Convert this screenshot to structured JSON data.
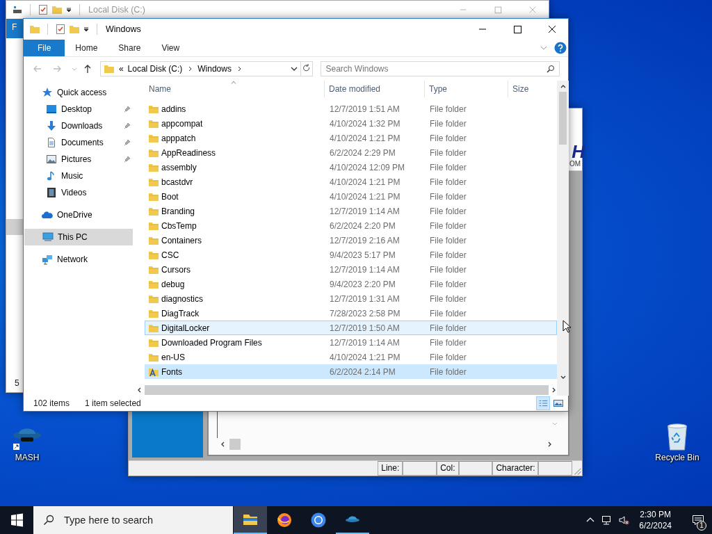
{
  "back_window": {
    "title": "Local Disk (C:)",
    "ribbon_tab": "F",
    "status_fragment": "5"
  },
  "editor_window": {
    "logo_mark": "H",
    "logo_caption": "OM",
    "status_bar": [
      {
        "label": "Line:"
      },
      {
        "label": "Col:"
      },
      {
        "label": "Character:"
      }
    ]
  },
  "explorer": {
    "title": "Windows",
    "ribbon_tabs": [
      {
        "label": "File",
        "selected": true
      },
      {
        "label": "Home",
        "selected": false
      },
      {
        "label": "Share",
        "selected": false
      },
      {
        "label": "View",
        "selected": false
      }
    ],
    "address": {
      "overflow": "«",
      "crumbs": [
        "Local Disk (C:)",
        "Windows"
      ]
    },
    "search": {
      "placeholder": "Search Windows"
    },
    "nav": [
      {
        "label": "Quick access",
        "kind": "star",
        "selected": false,
        "children": [
          {
            "label": "Desktop",
            "kind": "desktop",
            "pinned": true,
            "selected": false
          },
          {
            "label": "Downloads",
            "kind": "download",
            "pinned": true,
            "selected": false
          },
          {
            "label": "Documents",
            "kind": "document",
            "pinned": true,
            "selected": false
          },
          {
            "label": "Pictures",
            "kind": "pictures",
            "pinned": true,
            "selected": false
          },
          {
            "label": "Music",
            "kind": "music",
            "pinned": false,
            "selected": false
          },
          {
            "label": "Videos",
            "kind": "videos",
            "pinned": false,
            "selected": false
          }
        ]
      },
      {
        "label": "OneDrive",
        "kind": "cloud",
        "selected": false
      },
      {
        "label": "This PC",
        "kind": "pc",
        "selected": true
      },
      {
        "label": "Network",
        "kind": "network",
        "selected": false
      }
    ],
    "columns": [
      "Name",
      "Date modified",
      "Type",
      "Size"
    ],
    "rows": [
      {
        "name": "addins",
        "date": "12/7/2019 1:51 AM",
        "type": "File folder",
        "kind": "folder",
        "selected": false,
        "hovered": false
      },
      {
        "name": "appcompat",
        "date": "4/10/2024 1:32 PM",
        "type": "File folder",
        "kind": "folder",
        "selected": false,
        "hovered": false
      },
      {
        "name": "apppatch",
        "date": "4/10/2024 1:21 PM",
        "type": "File folder",
        "kind": "folder",
        "selected": false,
        "hovered": false
      },
      {
        "name": "AppReadiness",
        "date": "6/2/2024 2:29 PM",
        "type": "File folder",
        "kind": "folder",
        "selected": false,
        "hovered": false
      },
      {
        "name": "assembly",
        "date": "4/10/2024 12:09 PM",
        "type": "File folder",
        "kind": "folder",
        "selected": false,
        "hovered": false
      },
      {
        "name": "bcastdvr",
        "date": "4/10/2024 1:21 PM",
        "type": "File folder",
        "kind": "folder",
        "selected": false,
        "hovered": false
      },
      {
        "name": "Boot",
        "date": "4/10/2024 1:21 PM",
        "type": "File folder",
        "kind": "folder",
        "selected": false,
        "hovered": false
      },
      {
        "name": "Branding",
        "date": "12/7/2019 1:14 AM",
        "type": "File folder",
        "kind": "folder",
        "selected": false,
        "hovered": false
      },
      {
        "name": "CbsTemp",
        "date": "6/2/2024 2:20 PM",
        "type": "File folder",
        "kind": "folder",
        "selected": false,
        "hovered": false
      },
      {
        "name": "Containers",
        "date": "12/7/2019 2:16 AM",
        "type": "File folder",
        "kind": "folder",
        "selected": false,
        "hovered": false
      },
      {
        "name": "CSC",
        "date": "9/4/2023 5:17 PM",
        "type": "File folder",
        "kind": "folder",
        "selected": false,
        "hovered": false
      },
      {
        "name": "Cursors",
        "date": "12/7/2019 1:14 AM",
        "type": "File folder",
        "kind": "folder",
        "selected": false,
        "hovered": false
      },
      {
        "name": "debug",
        "date": "9/4/2023 2:20 PM",
        "type": "File folder",
        "kind": "folder",
        "selected": false,
        "hovered": false
      },
      {
        "name": "diagnostics",
        "date": "12/7/2019 1:31 AM",
        "type": "File folder",
        "kind": "folder",
        "selected": false,
        "hovered": false
      },
      {
        "name": "DiagTrack",
        "date": "7/28/2023 2:58 PM",
        "type": "File folder",
        "kind": "folder",
        "selected": false,
        "hovered": false
      },
      {
        "name": "DigitalLocker",
        "date": "12/7/2019 1:50 AM",
        "type": "File folder",
        "kind": "folder",
        "selected": false,
        "hovered": true
      },
      {
        "name": "Downloaded Program Files",
        "date": "12/7/2019 1:14 AM",
        "type": "File folder",
        "kind": "folder",
        "selected": false,
        "hovered": false
      },
      {
        "name": "en-US",
        "date": "4/10/2024 1:21 PM",
        "type": "File folder",
        "kind": "folder",
        "selected": false,
        "hovered": false
      },
      {
        "name": "Fonts",
        "date": "6/2/2024 2:14 PM",
        "type": "File folder",
        "kind": "fonts",
        "selected": true,
        "hovered": false
      }
    ],
    "status": {
      "count": "102 items",
      "selection": "1 item selected"
    },
    "view_buttons": [
      {
        "kind": "details",
        "selected": true
      },
      {
        "kind": "thumbnails",
        "selected": false
      }
    ]
  },
  "desktop_icons": [
    {
      "label": "MASH",
      "kind": "mash"
    },
    {
      "label": "Recycle Bin",
      "kind": "recycle"
    }
  ],
  "taskbar": {
    "search_placeholder": "Type here to search",
    "apps": [
      {
        "kind": "explorer",
        "active": true,
        "running": true
      },
      {
        "kind": "firefox",
        "active": false,
        "running": false
      },
      {
        "kind": "chrome",
        "active": false,
        "running": false
      },
      {
        "kind": "mash",
        "active": false,
        "running": true
      }
    ],
    "time": "2:30 PM",
    "date": "6/2/2024",
    "notifications": "1"
  }
}
